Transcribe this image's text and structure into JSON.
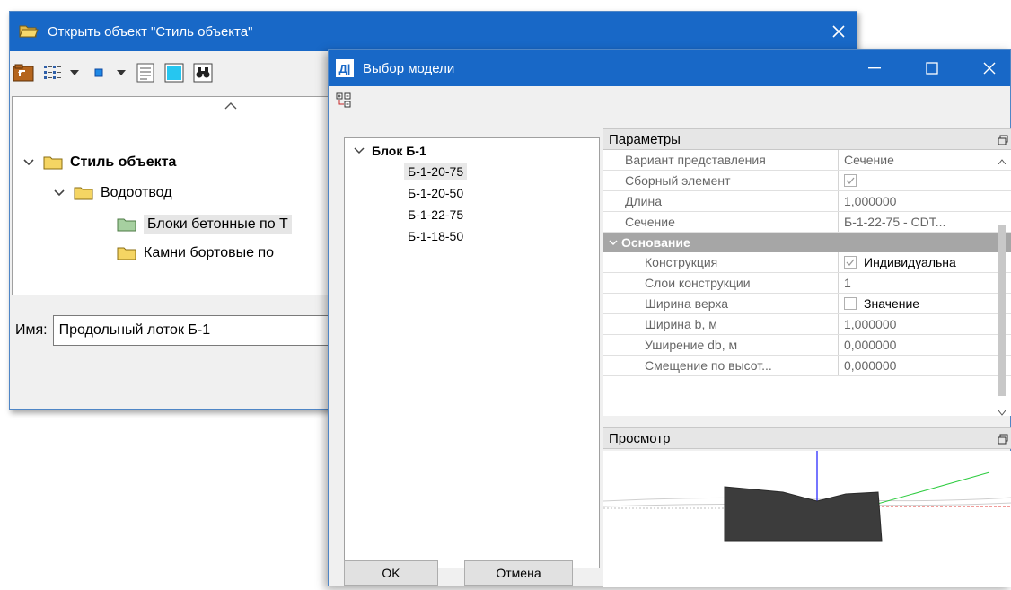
{
  "open_dialog": {
    "title": "Открыть объект \"Стиль объекта\"",
    "tree": {
      "root": "Стиль объекта",
      "child": "Водоотвод",
      "items": [
        "Блоки бетонные по Т",
        "Камни бортовые по"
      ]
    },
    "name_label": "Имя:",
    "name_value": "Продольный лоток Б-1"
  },
  "model_dialog": {
    "title": "Выбор модели",
    "app_icon": "Д|",
    "tree": {
      "root": "Блок Б-1",
      "items": [
        "Б-1-20-75",
        "Б-1-20-50",
        "Б-1-22-75",
        "Б-1-18-50"
      ]
    },
    "ok_label": "OK",
    "cancel_label": "Отмена",
    "params": {
      "header": "Параметры",
      "rows": [
        {
          "key": "Вариант представления",
          "value": "Сечение"
        },
        {
          "key": "Сборный элемент",
          "value": ""
        },
        {
          "key": "Длина",
          "value": "1,000000"
        },
        {
          "key": "Сечение",
          "value": "Б-1-22-75 - CDT..."
        }
      ],
      "section": "Основание",
      "sub_rows": [
        {
          "key": "Конструкция",
          "value": "Индивидуальна"
        },
        {
          "key": "Слои конструкции",
          "value": "1"
        },
        {
          "key": "Ширина верха",
          "value": "Значение"
        },
        {
          "key": "Ширина b, м",
          "value": "1,000000"
        },
        {
          "key": "Уширение db, м",
          "value": "0,000000"
        },
        {
          "key": "Смещение по высот...",
          "value": "0,000000"
        }
      ]
    },
    "preview_header": "Просмотр"
  },
  "colors": {
    "titlebar": "#1868c7",
    "section": "#a6a6a6",
    "folder": "#f5d563",
    "folder_selected": "#a6d0a0"
  }
}
